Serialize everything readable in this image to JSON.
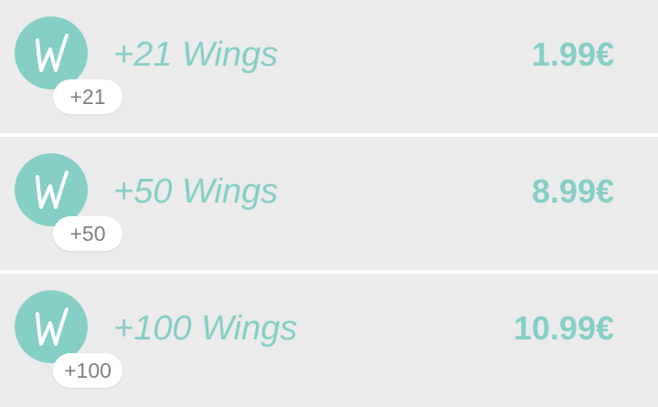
{
  "colors": {
    "accent": "#86cfc6",
    "row_background": "#ebebeb",
    "divider": "#ffffff",
    "badge_text": "#808080"
  },
  "products": [
    {
      "icon": "wings-w-logo-icon",
      "badge": "+21",
      "title": "+21 Wings",
      "price": "1.99€"
    },
    {
      "icon": "wings-w-logo-icon",
      "badge": "+50",
      "title": "+50 Wings",
      "price": "8.99€"
    },
    {
      "icon": "wings-w-logo-icon",
      "badge": "+100",
      "title": "+100 Wings",
      "price": "10.99€"
    }
  ]
}
